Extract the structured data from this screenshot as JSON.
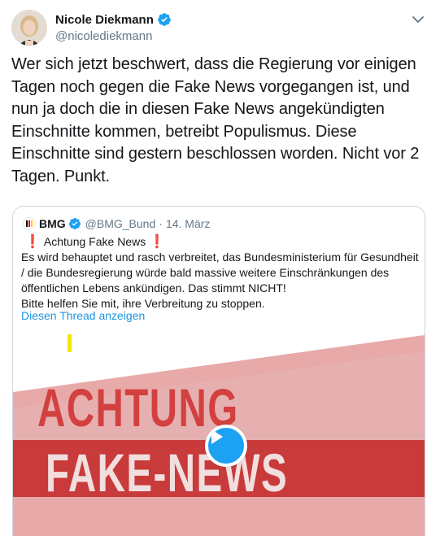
{
  "author": {
    "name": "Nicole Diekmann",
    "handle": "@nicolediekmann",
    "verified_icon": "verified-badge-icon",
    "menu_icon": "chevron-down-icon"
  },
  "tweet": {
    "text": "Wer sich jetzt beschwert, dass die Regierung vor einigen\nTagen noch gegen die Fake News vorgegangen ist, und\nnun ja doch die in diesen Fake News angekündigten\nEinschnitte kommen, betreibt Populismus. Diese\nEinschnitte sind gestern beschlossen worden. Nicht vor 2\nTagen. Punkt."
  },
  "quoted": {
    "name": "BMG",
    "handle": "@BMG_Bund",
    "separator": "·",
    "date": "14. März",
    "first_line": "Achtung Fake News",
    "lines": [
      "Es wird behauptet und rasch verbreitet, das Bundesministerium für Gesundheit",
      "/ die Bundesregierung würde bald massive weitere Einschränkungen des",
      "öffentlichen Lebens ankündigen. Das stimmt NICHT!",
      "Bitte helfen Sie mit, ihre Verbreitung zu stoppen."
    ],
    "thread_link": "Diesen Thread anzeigen",
    "emoji_mark": "❗",
    "media": {
      "title_line1": "ACHTUNG",
      "title_line2": "FAKE-NEWS",
      "play_icon": "play-icon"
    }
  },
  "colors": {
    "verified": "#1da1f2",
    "link": "#1b95e0",
    "secondary": "#657786",
    "accent_red": "#d23b3b",
    "accent_yellow": "#f5e400"
  }
}
